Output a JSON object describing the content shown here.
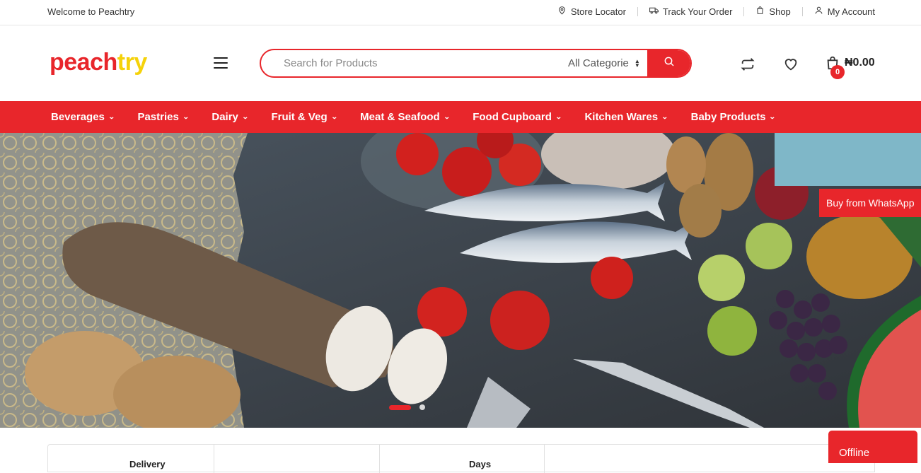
{
  "topbar": {
    "welcome": "Welcome to Peachtry",
    "store_locator": "Store Locator",
    "track_order": "Track Your Order",
    "shop": "Shop",
    "my_account": "My Account"
  },
  "header": {
    "logo_part1": "peach",
    "logo_part2": "try",
    "search_placeholder": "Search for Products",
    "category_select": "All Categorie",
    "cart_count": "0",
    "cart_total": "₦0.00",
    "icons": [
      "menu-icon",
      "compare-icon",
      "wishlist-heart-icon",
      "cart-bag-icon",
      "search-icon"
    ]
  },
  "nav": {
    "items": [
      {
        "label": "Beverages"
      },
      {
        "label": "Pastries"
      },
      {
        "label": "Dairy"
      },
      {
        "label": "Fruit & Veg"
      },
      {
        "label": "Meat & Seafood"
      },
      {
        "label": "Food Cupboard"
      },
      {
        "label": "Kitchen Wares"
      },
      {
        "label": "Baby Products"
      }
    ]
  },
  "hero": {
    "whatsapp_label": "Buy from WhatsApp",
    "slide_count": 2,
    "active_slide": 1
  },
  "features": {
    "item1": "Delivery",
    "item2": "Days"
  },
  "chat": {
    "status": "Offline"
  },
  "colors": {
    "brand_red": "#e8262b",
    "brand_yellow": "#f5d20a"
  }
}
